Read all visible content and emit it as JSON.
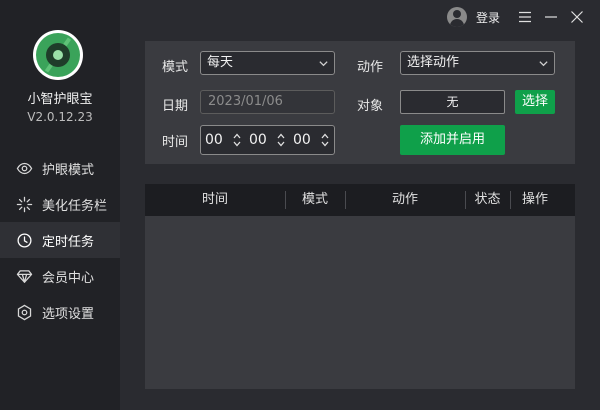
{
  "app": {
    "name": "小智护眼宝",
    "version": "V2.0.12.23"
  },
  "titlebar": {
    "login_label": "登录"
  },
  "nav": {
    "items": [
      {
        "label": "护眼模式",
        "icon": "eye-icon"
      },
      {
        "label": "美化任务栏",
        "icon": "sparkle-icon"
      },
      {
        "label": "定时任务",
        "icon": "clock-icon",
        "active": true
      },
      {
        "label": "会员中心",
        "icon": "diamond-icon"
      },
      {
        "label": "选项设置",
        "icon": "settings-icon"
      }
    ]
  },
  "form": {
    "mode_label": "模式",
    "mode_value": "每天",
    "action_label": "动作",
    "action_value": "选择动作",
    "date_label": "日期",
    "date_value": "2023/01/06",
    "target_label": "对象",
    "target_value": "无",
    "select_button": "选择",
    "time_label": "时间",
    "hour": "00",
    "minute": "00",
    "second": "00",
    "add_button": "添加并启用"
  },
  "table": {
    "columns": [
      "时间",
      "模式",
      "动作",
      "状态",
      "操作"
    ],
    "rows": []
  },
  "colors": {
    "accent": "#0fa04a",
    "sidebar": "#212226",
    "background": "#2a2b30",
    "panel": "#3a3b40"
  }
}
